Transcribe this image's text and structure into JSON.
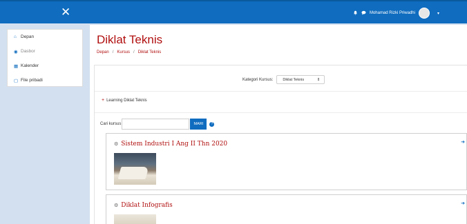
{
  "header": {
    "close_label": "✕",
    "user_name": "Mohamad Rizki Priwadhi",
    "bell_icon": "bell-icon",
    "chat_icon": "chat-icon",
    "caret": "▾"
  },
  "sidebar": {
    "items": [
      {
        "label": "Depan",
        "icon": "⌂"
      },
      {
        "label": "Dasbor",
        "icon": "◉"
      },
      {
        "label": "Kalender",
        "icon": "▦"
      },
      {
        "label": "File pribadi",
        "icon": "▢"
      }
    ]
  },
  "main": {
    "page_title": "Diklat Teknis",
    "breadcrumb": {
      "items": [
        "Depan",
        "Kursus",
        "Diklat Teknis"
      ],
      "separator": "/"
    },
    "category": {
      "label": "Kategori Kursus:",
      "selected": "Diklat Teknis",
      "arrow": "⇕"
    },
    "learning_link": "Learning Diklat Teknis",
    "search": {
      "label": "Cari kursus",
      "button": "MARI",
      "help": "?"
    },
    "courses": [
      {
        "title": "Sistem Industri I Ang II Thn 2020"
      },
      {
        "title": "Diklat Infografis"
      }
    ]
  }
}
